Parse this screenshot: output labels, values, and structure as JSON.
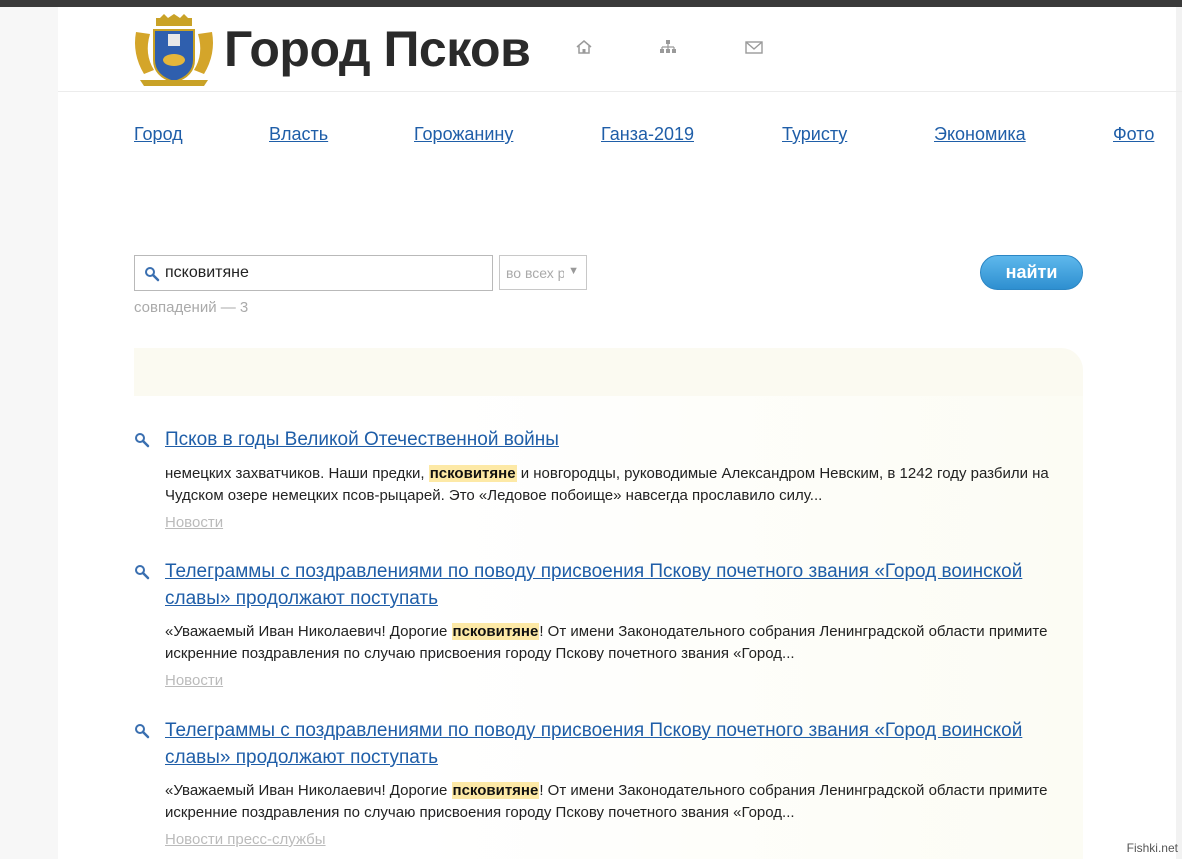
{
  "header": {
    "site_title": "Город Псков",
    "icons": [
      "home-icon",
      "sitemap-icon",
      "mail-icon"
    ]
  },
  "nav": {
    "items": [
      "Город",
      "Власть",
      "Горожанину",
      "Ганза-2019",
      "Туристу",
      "Экономика",
      "Фото"
    ]
  },
  "search": {
    "query": "псковитяне",
    "scope_label": "во всех р",
    "button_label": "найти",
    "matches_text": "совпадений — 3"
  },
  "results": [
    {
      "title": "Псков в годы Великой Отечественной войны",
      "snippet_before": "немецких захватчиков. Наши предки, ",
      "highlight": "псковитяне",
      "snippet_after": " и новгородцы, руководимые Александром Невским, в 1242 году разбили на Чудском озере немецких псов-рыцарей. Это «Ледовое побоище» навсегда прославило силу...",
      "category": "Новости"
    },
    {
      "title": "Телеграммы с поздравлениями по поводу присвоения Пскову почетного звания «Город воинской славы» продолжают поступать",
      "snippet_before": "«Уважаемый Иван Николаевич! Дорогие ",
      "highlight": "псковитяне",
      "snippet_after": "! От имени Законодательного собрания Ленинградской области примите искренние поздравления по случаю присвоения городу Пскову почетного звания «Город...",
      "category": "Новости"
    },
    {
      "title": "Телеграммы с поздравлениями по поводу присвоения Пскову почетного звания «Город воинской славы» продолжают поступать",
      "snippet_before": "«Уважаемый Иван Николаевич! Дорогие ",
      "highlight": "псковитяне",
      "snippet_after": "! От имени Законодательного собрания Ленинградской области примите искренние поздравления по случаю присвоения городу Пскову почетного звания «Город...",
      "category": "Новости пресс-службы"
    }
  ],
  "watermark": "Fishki.net",
  "colors": {
    "link": "#1f5ea8",
    "highlight": "#fde9a6",
    "button": "#2e8fd0"
  }
}
